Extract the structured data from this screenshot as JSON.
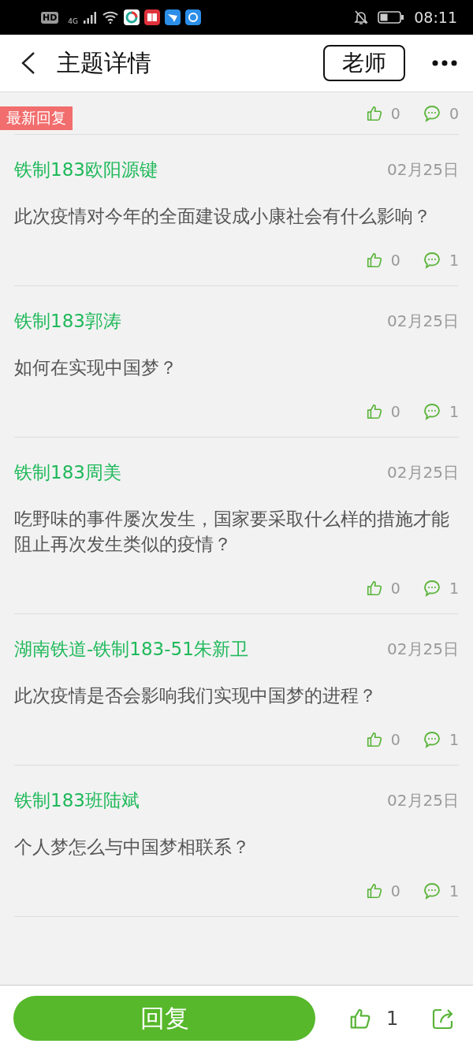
{
  "status_bar": {
    "hd_label": "HD",
    "network_label": "4G",
    "time": "08:11"
  },
  "header": {
    "title": "主题详情",
    "role_button": "老师"
  },
  "latest": {
    "badge": "最新回复",
    "likes": "0",
    "comments": "0"
  },
  "posts": [
    {
      "author": "铁制183欧阳源键",
      "date": "02月25日",
      "text": "此次疫情对今年的全面建设成小康社会有什么影响？",
      "likes": "0",
      "comments": "1"
    },
    {
      "author": "铁制183郭涛",
      "date": "02月25日",
      "text": "如何在实现中国梦？",
      "likes": "0",
      "comments": "1"
    },
    {
      "author": "铁制183周美",
      "date": "02月25日",
      "text": "吃野味的事件屡次发生，国家要采取什么样的措施才能阻止再次发生类似的疫情？",
      "likes": "0",
      "comments": "1"
    },
    {
      "author": "湖南铁道-铁制183-51朱新卫",
      "date": "02月25日",
      "text": "此次疫情是否会影响我们实现中国梦的进程？",
      "likes": "0",
      "comments": "1"
    },
    {
      "author": "铁制183班陆斌",
      "date": "02月25日",
      "text": "个人梦怎么与中国梦相联系？",
      "likes": "0",
      "comments": "1"
    }
  ],
  "footer": {
    "reply_button": "回复",
    "likes": "1"
  }
}
